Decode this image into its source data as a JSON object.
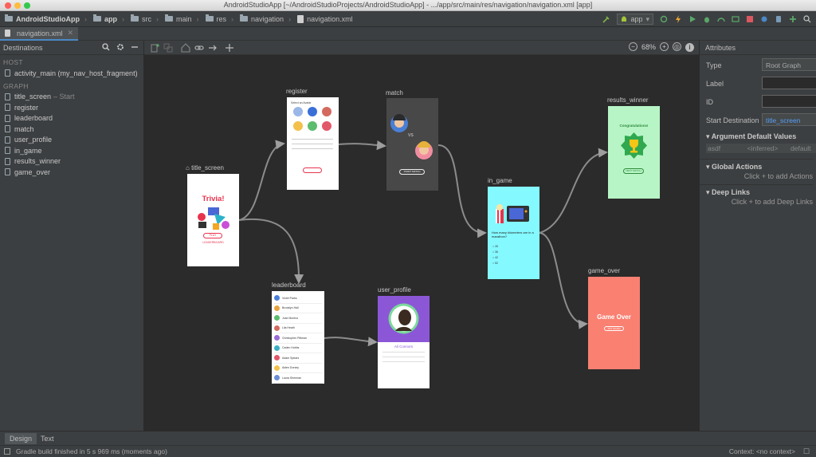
{
  "window": {
    "title": "AndroidStudioApp [~/AndroidStudioProjects/AndroidStudioApp] - .../app/src/main/res/navigation/navigation.xml [app]"
  },
  "breadcrumbs": [
    "AndroidStudioApp",
    "app",
    "src",
    "main",
    "res",
    "navigation",
    "navigation.xml"
  ],
  "run_config": "app",
  "editor_tab": "navigation.xml",
  "left_panel": {
    "title": "Destinations",
    "host_section": "HOST",
    "host_item": "activity_main (my_nav_host_fragment)",
    "graph_section": "GRAPH",
    "start_dest_label": "title_screen",
    "start_suffix": "– Start",
    "items": [
      "register",
      "leaderboard",
      "match",
      "user_profile",
      "in_game",
      "results_winner",
      "game_over"
    ]
  },
  "canvas": {
    "zoom": "68%",
    "nodes": {
      "title_screen": {
        "label": "title_screen",
        "heading": "Trivia!",
        "button": "PLAY",
        "link": "LEADERBOARD"
      },
      "register": {
        "label": "register",
        "heading": "Select an Avatar"
      },
      "match": {
        "label": "match",
        "vs": "VS",
        "button": "START MATCH"
      },
      "in_game": {
        "label": "in_game",
        "question": "How many kilometers are in a marathon?",
        "options": [
          "26",
          "36",
          "42",
          "52"
        ]
      },
      "results_winner": {
        "label": "results_winner",
        "heading": "Congratulations!",
        "button": "NEXT MATCH"
      },
      "game_over": {
        "label": "game_over",
        "heading": "Game Over",
        "button": "TRY AGAIN"
      },
      "leaderboard": {
        "label": "leaderboard",
        "rows": [
          "Violet Parks",
          "Brooklyn Hall",
          "Jose Moreno",
          "Lila Heath",
          "Christopher Pittman",
          "Caden Hobbs",
          "Adam Spears",
          "Aiden Dorsey",
          "Laura Sherman"
        ]
      },
      "user_profile": {
        "label": "user_profile",
        "name": "Ali Connors"
      }
    }
  },
  "right_panel": {
    "title": "Attributes",
    "type_label": "Type",
    "type_value": "Root Graph",
    "label_label": "Label",
    "id_label": "ID",
    "start_label": "Start Destination",
    "start_value": "title_screen",
    "arg_defaults_title": "Argument Default Values",
    "arg_row": [
      "asdf",
      "<inferred>",
      "default"
    ],
    "global_actions_title": "Global Actions",
    "global_actions_hint": "Click + to add Actions",
    "deep_links_title": "Deep Links",
    "deep_links_hint": "Click + to add Deep Links"
  },
  "bottom_tabs": [
    "Design",
    "Text"
  ],
  "status": {
    "message": "Gradle build finished in 5 s 969 ms (moments ago)",
    "context": "Context: <no context>"
  },
  "colors": {
    "accent": "#4a88c7",
    "in_game_bg": "#84f9ff",
    "results_bg": "#b7f5c6",
    "game_over_bg": "#fa8072",
    "profile_purple": "#8c57d7",
    "trivia_red": "#e8334d"
  }
}
